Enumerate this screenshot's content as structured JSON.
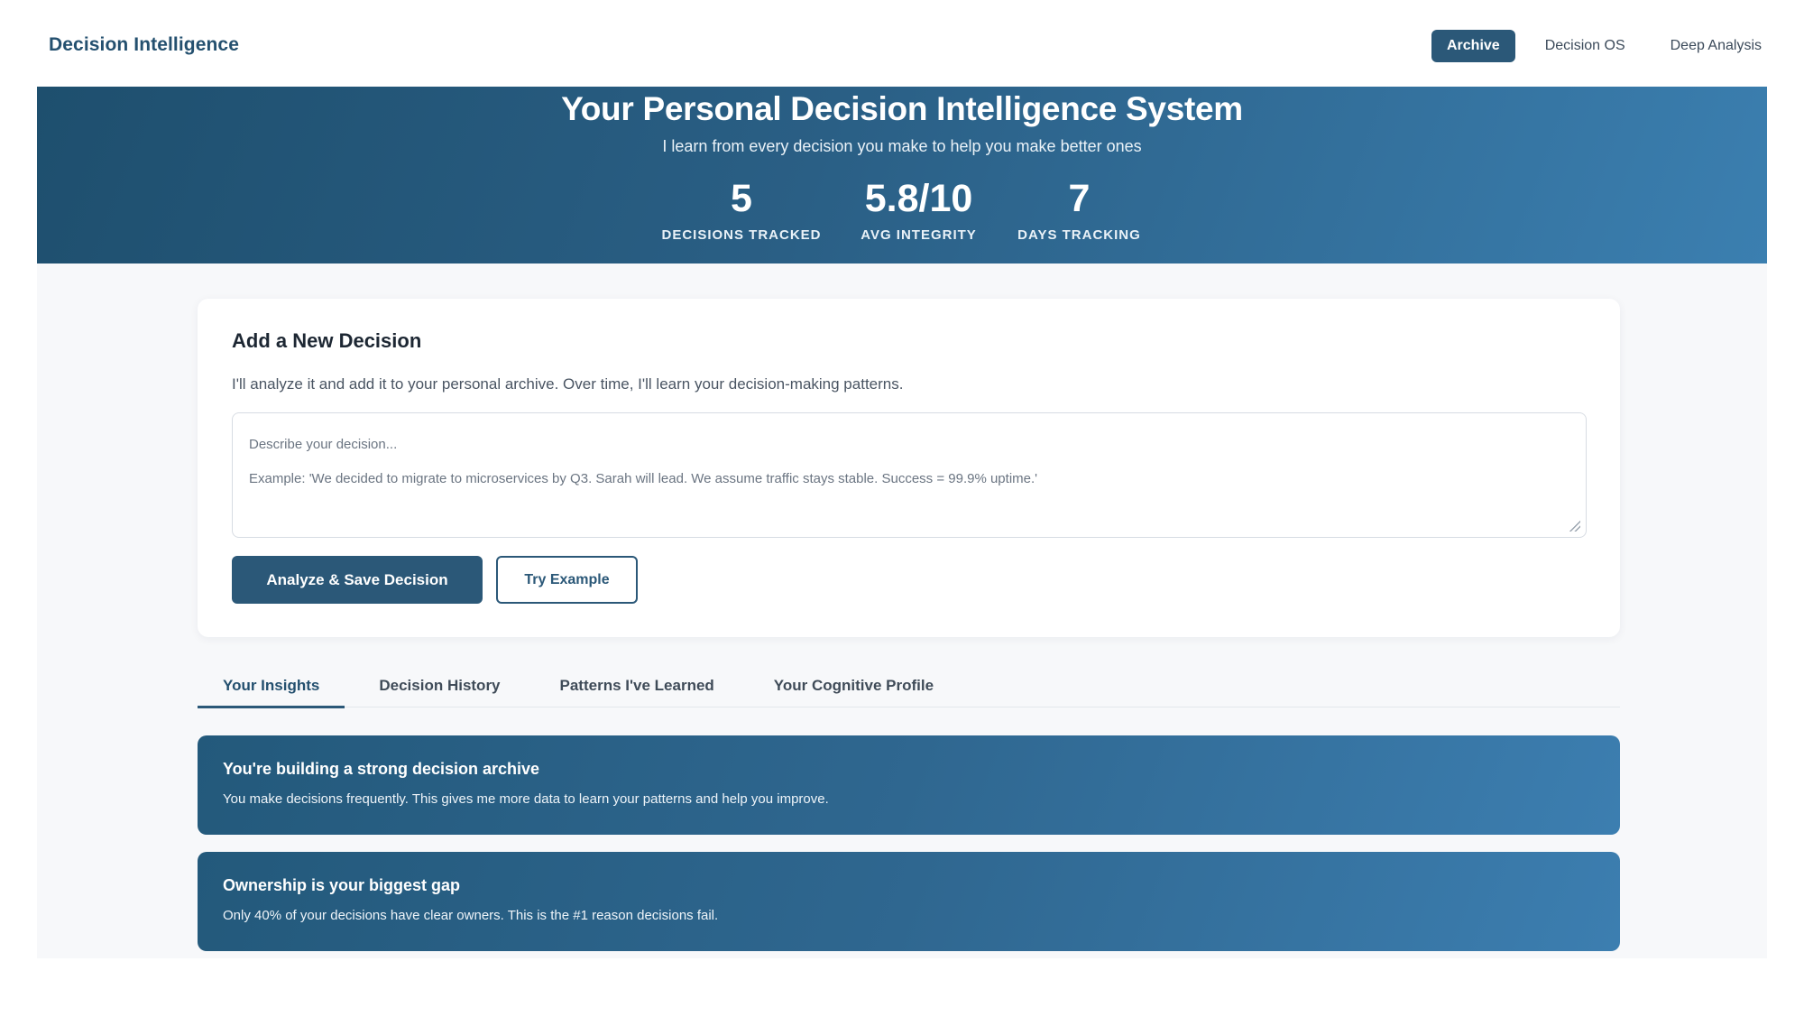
{
  "nav": {
    "brand": "Decision Intelligence",
    "tabs": [
      {
        "label": "Archive",
        "active": true
      },
      {
        "label": "Decision OS",
        "active": false
      },
      {
        "label": "Deep Analysis",
        "active": false
      }
    ]
  },
  "hero": {
    "title": "Your Personal Decision Intelligence System",
    "subtitle": "I learn from every decision you make to help you make better ones",
    "stats": [
      {
        "value": "5",
        "label": "DECISIONS TRACKED"
      },
      {
        "value": "5.8/10",
        "label": "AVG INTEGRITY"
      },
      {
        "value": "7",
        "label": "DAYS TRACKING"
      }
    ]
  },
  "add_decision": {
    "title": "Add a New Decision",
    "description": "I'll analyze it and add it to your personal archive. Over time, I'll learn your decision-making patterns.",
    "placeholder_line1": "Describe your decision...",
    "placeholder_line2": "Example: 'We decided to migrate to microservices by Q3. Sarah will lead. We assume traffic stays stable. Success = 99.9% uptime.'",
    "primary_button": "Analyze & Save Decision",
    "secondary_button": "Try Example"
  },
  "tabs": [
    {
      "label": "Your Insights",
      "active": true
    },
    {
      "label": "Decision History",
      "active": false
    },
    {
      "label": "Patterns I've Learned",
      "active": false
    },
    {
      "label": "Your Cognitive Profile",
      "active": false
    }
  ],
  "insights": [
    {
      "title": "You're building a strong decision archive",
      "body": "You make decisions frequently. This gives me more data to learn your patterns and help you improve."
    },
    {
      "title": "Ownership is your biggest gap",
      "body": "Only 40% of your decisions have clear owners. This is the #1 reason decisions fail."
    }
  ],
  "colors": {
    "accent": "#2b5878",
    "hero_gradient_start": "#1e4f6e",
    "hero_gradient_end": "#3b7fb0",
    "canvas_bg": "#f7f8fa"
  }
}
